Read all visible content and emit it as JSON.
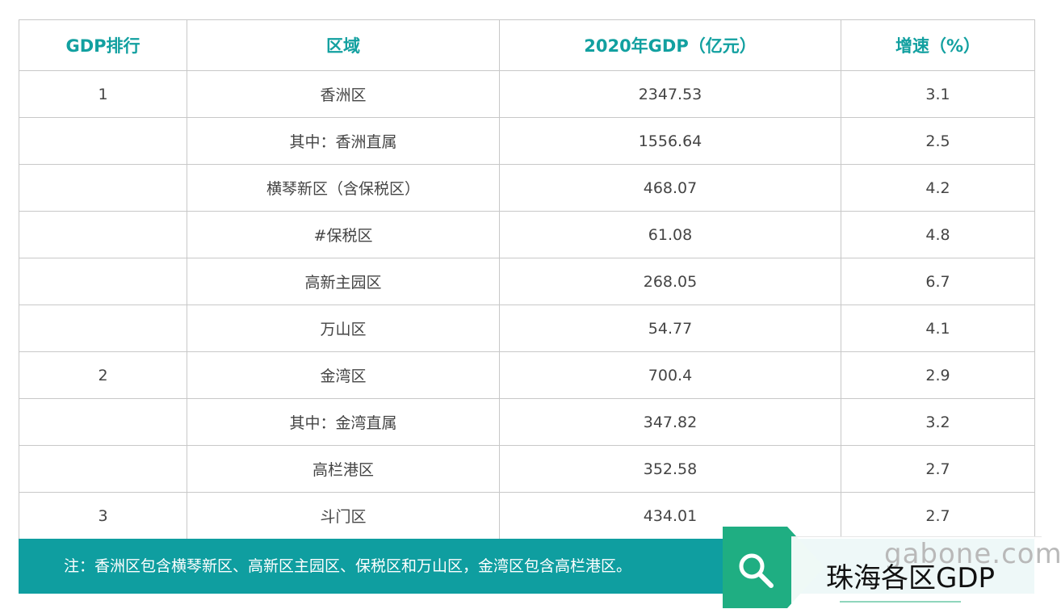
{
  "table": {
    "headers": [
      "GDP排行",
      "区域",
      "2020年GDP（亿元）",
      "增速（%）"
    ],
    "rows": [
      [
        "1",
        "香洲区",
        "2347.53",
        "3.1"
      ],
      [
        "",
        "其中：香洲直属",
        "1556.64",
        "2.5"
      ],
      [
        "",
        "横琴新区（含保税区）",
        "468.07",
        "4.2"
      ],
      [
        "",
        "#保税区",
        "61.08",
        "4.8"
      ],
      [
        "",
        "高新主园区",
        "268.05",
        "6.7"
      ],
      [
        "",
        "万山区",
        "54.77",
        "4.1"
      ],
      [
        "2",
        "金湾区",
        "700.4",
        "2.9"
      ],
      [
        "",
        "其中：金湾直属",
        "347.82",
        "3.2"
      ],
      [
        "",
        "高栏港区",
        "352.58",
        "2.7"
      ],
      [
        "3",
        "斗门区",
        "434.01",
        "2.7"
      ]
    ]
  },
  "note": "注：香洲区包含横琴新区、高新区主园区、保税区和万山区，金湾区包含高栏港区。",
  "search": {
    "query": "珠海各区GDP",
    "watermark": "gabone.com",
    "icon": "search-icon",
    "accent_color": "#1fae82"
  },
  "colors": {
    "header_text": "#12a0a0",
    "note_bg": "#0f9ea0"
  }
}
